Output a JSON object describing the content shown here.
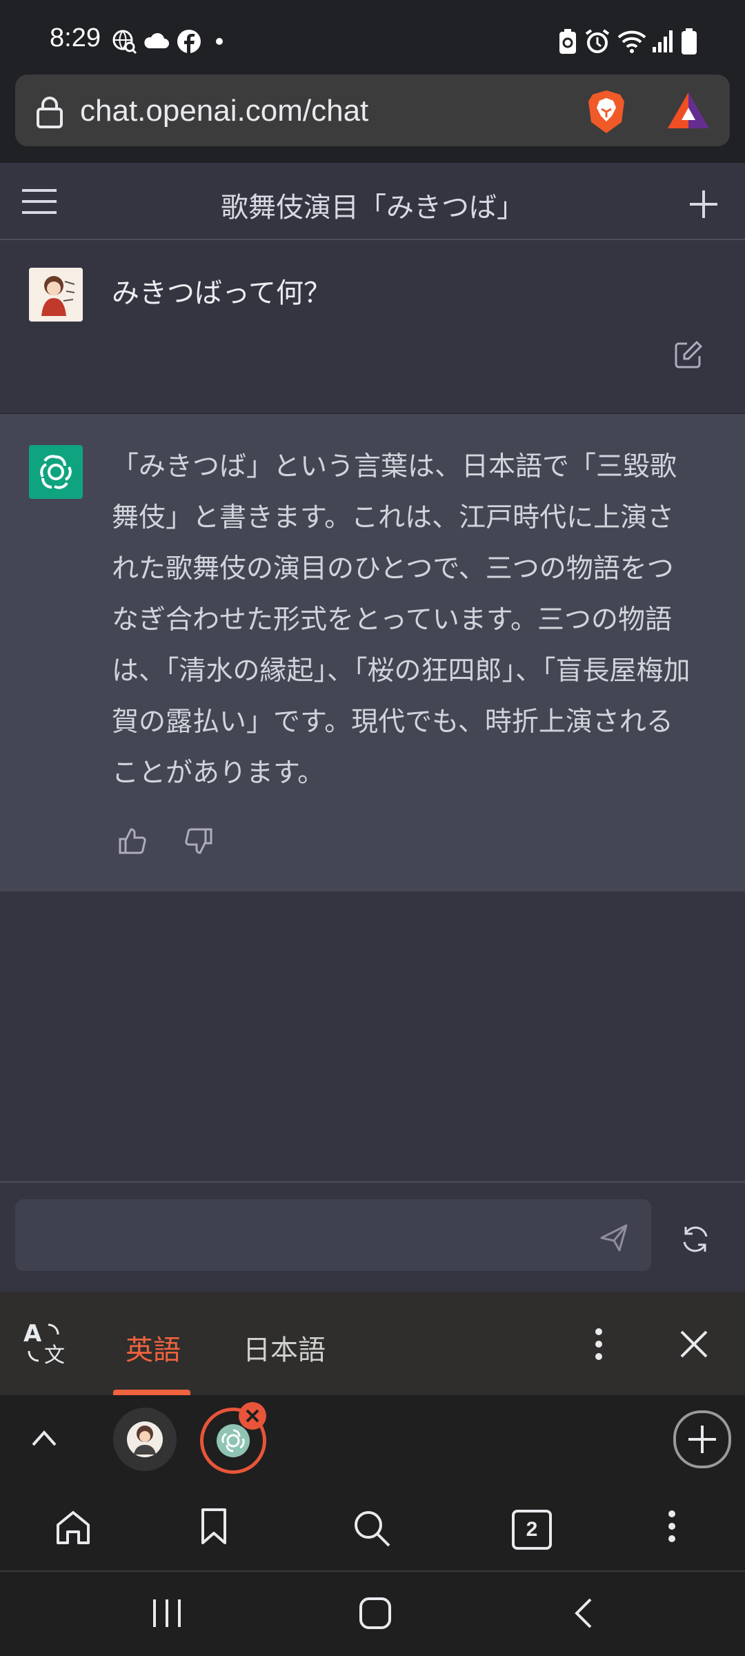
{
  "status_bar": {
    "time": "8:29",
    "left_icons": [
      "globe-search-icon",
      "cloud-icon",
      "facebook-icon",
      "dot-icon"
    ],
    "right_icons": [
      "battery-saver-icon",
      "alarm-icon",
      "wifi-icon",
      "signal-icon",
      "battery-icon"
    ]
  },
  "browser": {
    "url": "chat.openai.com/chat",
    "icons": [
      "lock-icon",
      "brave-shield-icon",
      "brave-rewards-icon"
    ]
  },
  "chat": {
    "title": "歌舞伎演目「みきつば」",
    "user_message": "みきつばって何？",
    "assistant_message": "「みきつば」という言葉は、日本語で「三毀歌舞伎」と書きます。これは、江戸時代に上演された歌舞伎の演目のひとつで、三つの物語をつなぎ合わせた形式をとっています。三つの物語は、「清水の縁起」、「桜の狂四郎」、「盲長屋梅加賀の露払い」です。現代でも、時折上演されることがあります。",
    "composer_placeholder": ""
  },
  "translate_bar": {
    "lang_source": "英語",
    "lang_target": "日本語",
    "active": "英語"
  },
  "tabs": {
    "count": "2"
  },
  "colors": {
    "accent": "#f0633e",
    "chatgpt_green": "#10a37f",
    "assistant_bg": "#444654",
    "user_bg": "#343541"
  }
}
